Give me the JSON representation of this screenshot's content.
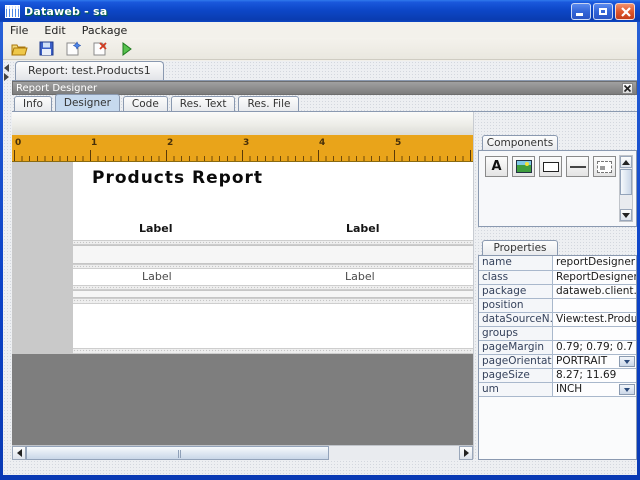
{
  "window": {
    "title": "Dataweb - sa"
  },
  "menubar": {
    "items": [
      "File",
      "Edit",
      "Package"
    ]
  },
  "toolbar": {
    "icons": [
      "open-icon",
      "save-icon",
      "new-report-icon",
      "delete-report-icon",
      "run-icon"
    ]
  },
  "document_tabs": {
    "active": "Report: test.Products1"
  },
  "designer": {
    "title": "Report Designer",
    "tabs": [
      "Info",
      "Designer",
      "Code",
      "Res. Text",
      "Res. File"
    ],
    "active_tab": "Designer"
  },
  "ruler": {
    "units": [
      "0",
      "1",
      "2",
      "3",
      "4",
      "5"
    ]
  },
  "report": {
    "title": "Products Report",
    "header_labels": [
      "Label",
      "Label"
    ],
    "detail_labels": [
      "Label",
      "Label"
    ]
  },
  "components": {
    "tab": "Components",
    "label_glyph": "A",
    "items": [
      "label-component",
      "image-component",
      "rectangle-component",
      "line-component",
      "panel-component"
    ]
  },
  "properties": {
    "tab": "Properties",
    "rows": [
      {
        "name": "name",
        "value": "reportDesigner"
      },
      {
        "name": "class",
        "value": "ReportDesigner"
      },
      {
        "name": "package",
        "value": "dataweb.client."
      },
      {
        "name": "position",
        "value": ""
      },
      {
        "name": "dataSourceN...",
        "value": "View:test.Produ"
      },
      {
        "name": "groups",
        "value": ""
      },
      {
        "name": "pageMargin",
        "value": "0.79; 0.79; 0.7"
      },
      {
        "name": "pageOrientat...",
        "value": "PORTRAIT",
        "editor": "dropdown"
      },
      {
        "name": "pageSize",
        "value": "8.27; 11.69"
      },
      {
        "name": "um",
        "value": "INCH",
        "editor": "dropdown"
      }
    ]
  },
  "colors": {
    "titlebar_blue": "#0D47C8",
    "ruler_orange": "#E9A41A",
    "selected_tab_blue": "#C6D9EE",
    "panel_header_gray": "#8B8B8B",
    "canvas_void_gray": "#7E7E7E"
  }
}
